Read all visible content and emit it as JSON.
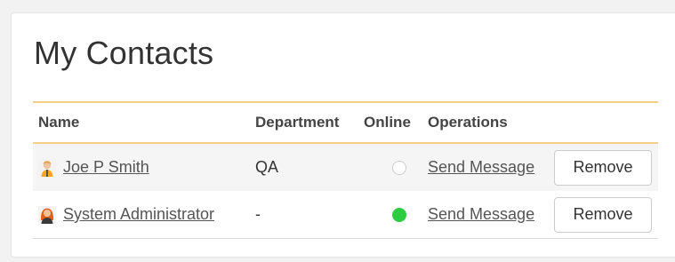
{
  "page": {
    "title": "My Contacts"
  },
  "table": {
    "headers": {
      "name": "Name",
      "department": "Department",
      "online": "Online",
      "operations": "Operations"
    },
    "rows": [
      {
        "name": "Joe P Smith",
        "avatar": "male-user-avatar-icon",
        "department": "QA",
        "online": false,
        "send_message": "Send Message",
        "remove": "Remove"
      },
      {
        "name": "System Administrator",
        "avatar": "female-user-avatar-icon",
        "department": "-",
        "online": true,
        "send_message": "Send Message",
        "remove": "Remove"
      }
    ]
  },
  "colors": {
    "header_accent": "#f6cf86",
    "online": "#2ecc40"
  }
}
